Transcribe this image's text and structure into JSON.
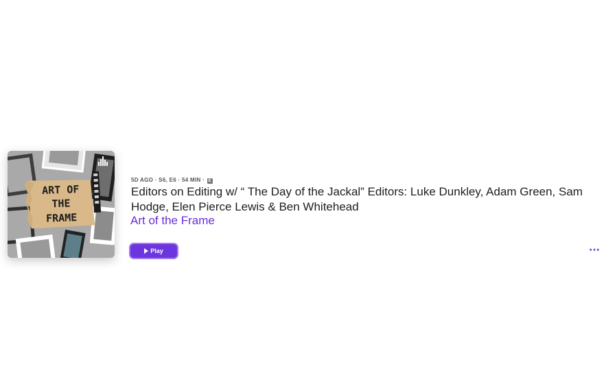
{
  "episode": {
    "meta": "5D AGO · S6, E6 · 54 MIN ·",
    "explicit_badge": "E",
    "title": "Editors on Editing w/ “ The Day of the Jackal” Editors: Luke Dunkley, Adam Green, Sam Hodge, Elen Pierce Lewis & Ben Whitehead",
    "show_name": "Art of the Frame",
    "artwork_text_lines": [
      "ART OF",
      "THE",
      "FRAME"
    ]
  },
  "actions": {
    "play_label": "Play",
    "more_label": "···"
  },
  "colors": {
    "accent": "#6c35de",
    "link": "#6a2bd9",
    "title": "#1d1d1f"
  },
  "icons": {
    "play": "play-icon",
    "more": "ellipsis-icon",
    "podcast": "podcast-waves-icon"
  }
}
